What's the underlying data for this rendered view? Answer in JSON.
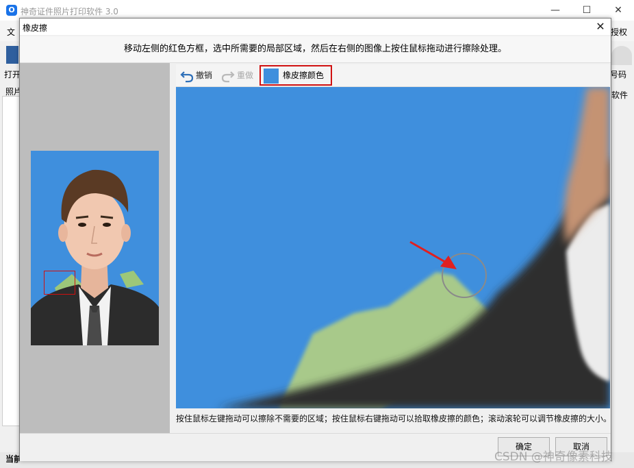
{
  "app": {
    "title": "神奇证件照片打印软件 3.0",
    "logo_text": "O",
    "menu_partial": "文",
    "menu_right_partial": "授权",
    "toolbar_left_partial": "打开",
    "toolbar_right_partial": "号码",
    "side_label_partial": "照片",
    "side_right_partial": "软件",
    "status_partial": "当前照片"
  },
  "dialog": {
    "title": "橡皮擦",
    "instruction": "移动左侧的红色方框，选中所需要的局部区域，然后在右侧的图像上按住鼠标拖动进行擦除处理。",
    "toolbar": {
      "undo_label": "撤销",
      "redo_label": "重做",
      "color_label": "橡皮擦颜色",
      "eraser_color": "#3f8fdd"
    },
    "hint": "按住鼠标左键拖动可以擦除不需要的区域；按住鼠标右键拖动可以拾取橡皮擦的颜色；滚动滚轮可以调节橡皮擦的大小。",
    "ok_label": "确定",
    "cancel_label": "取消"
  },
  "watermark": "CSDN @神奇像素科技",
  "colors": {
    "background_blue": "#3f8fdd",
    "highlight_red": "#d01010"
  }
}
